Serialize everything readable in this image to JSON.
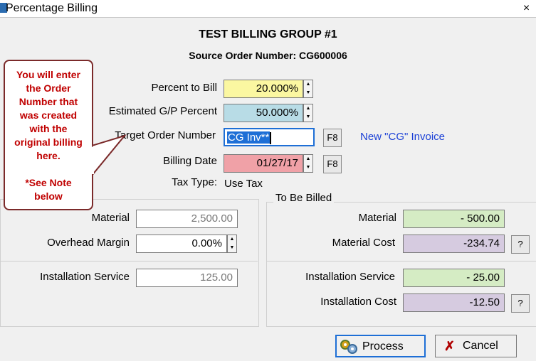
{
  "window": {
    "title": "Percentage Billing",
    "close_glyph": "×"
  },
  "header": {
    "group_title": "TEST BILLING GROUP #1",
    "source_order": "Source Order Number: CG600006"
  },
  "callout": {
    "lines": [
      "You will enter",
      "the Order",
      "Number that",
      "was created",
      "with the",
      "original billing",
      "here.",
      "",
      "*See Note",
      "below"
    ]
  },
  "form": {
    "percent_label": "Percent to Bill",
    "percent_value": "20.000%",
    "gp_label": "Estimated G/P Percent",
    "gp_value": "50.000%",
    "target_label": "Target Order Number",
    "target_value": "CG Inv**",
    "f8_label": "F8",
    "new_invoice_link": "New \"CG\" Invoice",
    "billing_date_label": "Billing Date",
    "billing_date_value": "01/27/17",
    "tax_type_label": "Tax Type:",
    "tax_type_value": "Use Tax"
  },
  "left": {
    "material_label": "Material",
    "material_value": "2,500.00",
    "overhead_label": "Overhead Margin",
    "overhead_value": "0.00%",
    "install_label": "Installation Service",
    "install_value": "125.00"
  },
  "right": {
    "group_title": "To Be Billed",
    "material_label": "Material",
    "material_value": "- 500.00",
    "material_cost_label": "Material Cost",
    "material_cost_value": "-234.74",
    "install_label": "Installation Service",
    "install_value": "- 25.00",
    "install_cost_label": "Installation Cost",
    "install_cost_value": "-12.50",
    "help_label": "?"
  },
  "buttons": {
    "process": "Process",
    "cancel": "Cancel"
  },
  "colors": {
    "yellow": "#fbf7a1",
    "blue": "#b8dce6",
    "pink": "#f0a1a7",
    "green": "#d5ecc4",
    "purple": "#d6cbe0",
    "link": "#1a3fd6",
    "callout_text": "#c00000"
  },
  "icons": {
    "spin": "spin-arrows-icon",
    "process": "gears-icon",
    "cancel": "x-icon",
    "app": "app-icon"
  }
}
